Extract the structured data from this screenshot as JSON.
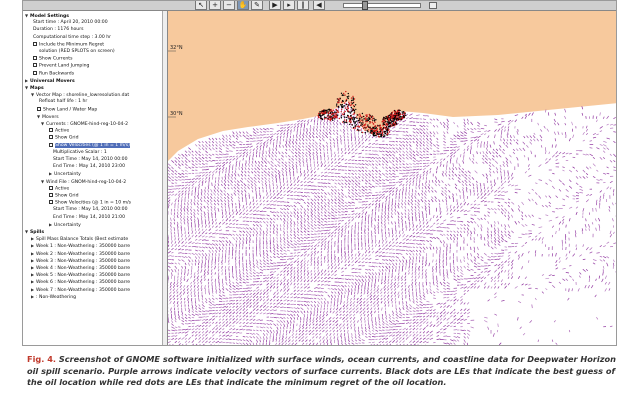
{
  "panel": {
    "rows": [
      {
        "tri": "▼",
        "text": "Model Settings",
        "section": true,
        "indent": 2
      },
      {
        "text": "Start time : April 20, 2010 00:00",
        "indent": 10
      },
      {
        "text": "Duration : 1176 hours",
        "indent": 10
      },
      {
        "text": "Computational time step : 3.00 hr",
        "indent": 10
      },
      {
        "box": true,
        "text": "Include the Minimum Regret",
        "indent": 10
      },
      {
        "text": "solution (RED SPLOTS on screen)",
        "indent": 16
      },
      {
        "box": true,
        "text": "Show Currents",
        "indent": 10
      },
      {
        "box": true,
        "text": "Prevent Land Jumping",
        "indent": 10
      },
      {
        "box": true,
        "text": "Run Backwards",
        "indent": 10
      },
      {
        "tri": "▶",
        "text": "Universal Movers",
        "section": true,
        "indent": 2
      },
      {
        "tri": "▼",
        "text": "Maps",
        "section": true,
        "indent": 2
      },
      {
        "tri": "▼",
        "text": "Vector Map : shoreline_lowresolution.dat",
        "indent": 8
      },
      {
        "text": "Refloat half life : 1 hr",
        "indent": 16
      },
      {
        "box": true,
        "text": "Show Land / Water Map",
        "indent": 14
      },
      {
        "tri": "▼",
        "text": "Movers",
        "indent": 14
      },
      {
        "tri": "▼",
        "text": "Currents : GNOME-hind-reg-10-04-2",
        "indent": 18
      },
      {
        "box": true,
        "text": "Active",
        "indent": 26
      },
      {
        "box": true,
        "text": "Show Grid",
        "indent": 26
      },
      {
        "box": true,
        "text": "Show Velocities (@ 1 in = 1 m/s)",
        "indent": 26,
        "hl": true
      },
      {
        "text": "Multiplicative Scalar : 1",
        "indent": 30
      },
      {
        "text": "Start Time : May 14, 2010 00:00",
        "indent": 30
      },
      {
        "text": "End Time : May 14, 2010 23:00",
        "indent": 30
      },
      {
        "tri": "▶",
        "text": "Uncertainty",
        "indent": 26
      },
      {
        "tri": "▼",
        "text": "Wind File : GNOM-hind-reg-10-04-2",
        "indent": 18
      },
      {
        "box": true,
        "text": "Active",
        "indent": 26
      },
      {
        "box": true,
        "text": "Show Grid",
        "indent": 26
      },
      {
        "box": true,
        "text": "Show Velocities (@ 1 in = 10 m/s",
        "indent": 26
      },
      {
        "text": "Start Time : May 14, 2010 00:00",
        "indent": 30
      },
      {
        "text": "End Time : May 14, 2010 21:00",
        "indent": 30
      },
      {
        "tri": "▶",
        "text": "Uncertainty",
        "indent": 26
      },
      {
        "tri": "▼",
        "text": "Spills",
        "section": true,
        "indent": 2
      },
      {
        "tri": "▶",
        "text": "Spill Mass Balance Totals (Best estimate",
        "indent": 8
      },
      {
        "tri": "▶",
        "text": "Week 1 : Non-Weathering : 350000 barre",
        "indent": 8
      },
      {
        "tri": "▶",
        "text": "Week 2 : Non-Weathering : 350000 barre",
        "indent": 8
      },
      {
        "tri": "▶",
        "text": "Week 3 : Non-Weathering : 350000 barre",
        "indent": 8
      },
      {
        "tri": "▶",
        "text": "Week 4 : Non-Weathering : 350000 barre",
        "indent": 8
      },
      {
        "tri": "▶",
        "text": "Week 5 : Non-Weathering : 350000 barre",
        "indent": 8
      },
      {
        "tri": "▶",
        "text": "Week 6 : Non-Weathering : 350000 barre",
        "indent": 8
      },
      {
        "tri": "▶",
        "text": "Week 7 : Non-Weathering : 350000 barre",
        "indent": 8
      },
      {
        "tri": "▶",
        "text": ": Non-Weathering",
        "indent": 8
      }
    ]
  },
  "map": {
    "lat_top": "32°N",
    "lat_mid": "30°N",
    "land_color": "#f7c99d",
    "water_color": "#ffffff",
    "vector_color": "#8a2a9a",
    "best_guess_color": "#000000",
    "min_regret_color": "#d11a1a"
  },
  "caption": {
    "fig": "Fig. 4.",
    "text": "Screenshot of GNOME software initialized with surface winds, ocean currents, and coastline data for Deepwater Horizon oil spill scenario. Purple arrows indicate velocity vectors of surface currents. Black dots are LEs that indicate the best guess of the oil location while red dots are LEs that indicate the minimum regret of the oil location."
  }
}
